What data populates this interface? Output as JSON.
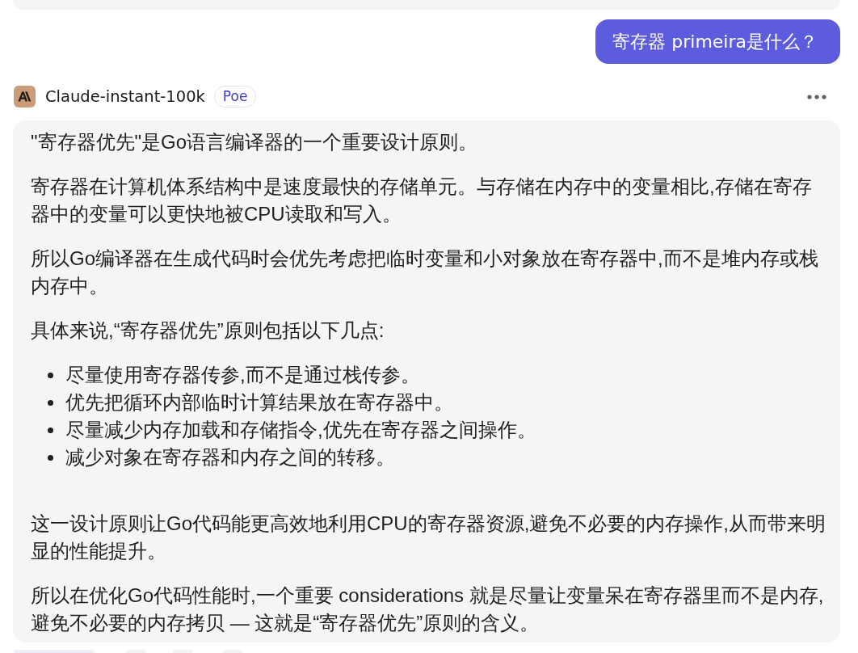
{
  "user_message": {
    "text": "寄存器 primeira是什么？"
  },
  "bot_message": {
    "author": "Claude-instant-100k",
    "badge": "Poe",
    "content": [
      {
        "kind": "paragraph",
        "text": "\"寄存器优先\"是Go语言编译器的一个重要设计原则。"
      },
      {
        "kind": "paragraph",
        "text": "寄存器在计算机体系结构中是速度最快的存储单元。与存储在内存中的变量相比,存储在寄存器中的变量可以更快地被CPU读取和写入。"
      },
      {
        "kind": "paragraph",
        "text": "所以Go编译器在生成代码时会优先考虑把临时变量和小对象放在寄存器中,而不是堆内存或栈内存中。"
      },
      {
        "kind": "paragraph",
        "text": "具体来说,“寄存器优先”原则包括以下几点:"
      },
      {
        "kind": "list",
        "items": [
          "尽量使用寄存器传参,而不是通过栈传参。",
          "优先把循环内部临时计算结果放在寄存器中。",
          "尽量减少内存加载和存储指令,优先在寄存器之间操作。",
          "减少对象在寄存器和内存之间的转移。"
        ]
      },
      {
        "kind": "paragraph",
        "text": "这一设计原则让Go代码能更高效地利用CPU的寄存器资源,避免不必要的内存操作,从而带来明显的性能提升。"
      },
      {
        "kind": "paragraph",
        "text": "所以在优化Go代码性能时,一个重要 considerations 就是尽量让变量呆在寄存器里而不是内存,避免不必要的内存拷贝 — 这就是“寄存器优先”原则的含义。"
      }
    ]
  }
}
